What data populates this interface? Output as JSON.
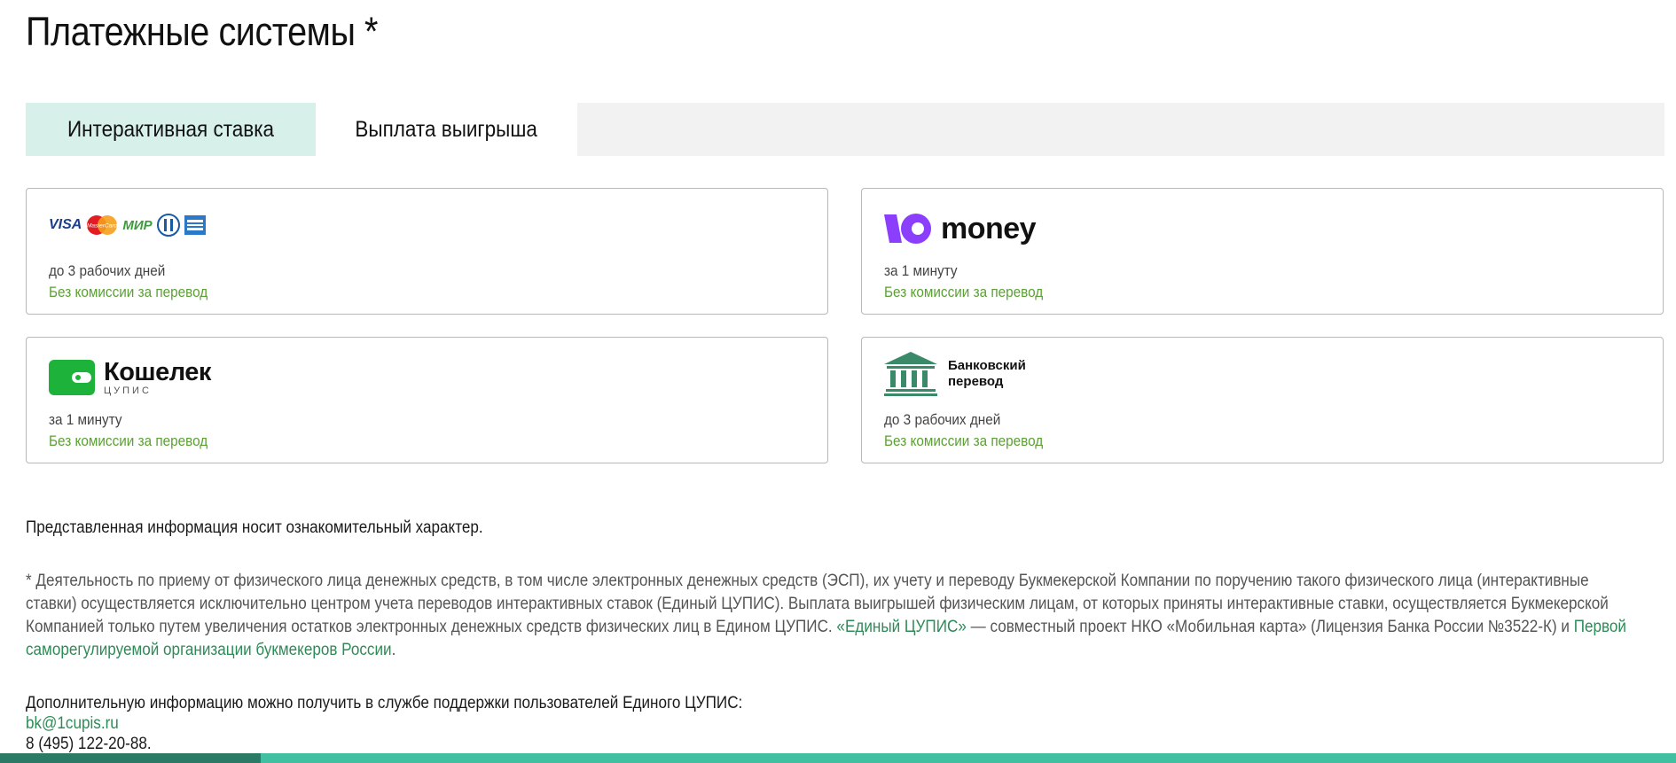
{
  "page": {
    "title": "Платежные системы *"
  },
  "tabs": [
    {
      "label": "Интерактивная ставка",
      "active": false
    },
    {
      "label": "Выплата выигрыша",
      "active": true
    }
  ],
  "cards": [
    {
      "logo": {
        "icons": [
          "visa-icon",
          "mastercard-icon",
          "mir-icon",
          "diners-club-icon",
          "amex-icon"
        ],
        "visa_text": "VISA",
        "mastercard_text": "MasterCard",
        "mir_text": "МИР"
      },
      "time": "до 3 рабочих дней",
      "fee": "Без комиссии за перевод"
    },
    {
      "logo": {
        "icon": "yoomoney-icon",
        "text": "money"
      },
      "time": "за 1 минуту",
      "fee": "Без комиссии за перевод"
    },
    {
      "logo": {
        "icon": "wallet-icon",
        "text": "Кошелек",
        "sub": "ЦУПИС"
      },
      "time": "за 1 минуту",
      "fee": "Без комиссии за перевод"
    },
    {
      "logo": {
        "icon": "bank-building-icon",
        "line1": "Банковский",
        "line2": "перевод"
      },
      "time": "до 3 рабочих дней",
      "fee": "Без комиссии за перевод"
    }
  ],
  "info": {
    "disclaimer": "Представленная информация носит ознакомительный характер.",
    "note_part1": "*  Деятельность по приему от физического лица денежных средств, в том числе электронных денежных средств (ЭСП), их учету и переводу Букмекерской Компании по поручению такого физического лица (интерактивные ставки) осуществляется исключительно центром учета переводов интерактивных ставок (Единый ЦУПИС). Выплата выигрышей физическим лицам, от которых приняты интерактивные ставки, осуществляется Букмекерской Компанией только путем увеличения остатков электронных денежных средств физических лиц в Едином ЦУПИС. ",
    "note_link1": "«Единый ЦУПИС»",
    "note_part2": " — совместный проект НКО «Мобильная карта» (Лицензия Банка России №3522-К) и ",
    "note_link2": "Первой саморегулируемой организации букмекеров России",
    "note_part3": ".",
    "support_text": "Дополнительную информацию можно получить в службе поддержки пользователей Единого ЦУПИС:",
    "email": "bk@1cupis.ru",
    "phone": "8 (495) 122-20-88."
  },
  "colors": {
    "accent_green": "#5ca035",
    "link_green": "#2e8b57",
    "tab_active_bg": "#d8f0ea",
    "yoomoney_purple": "#8b3ffd",
    "wallet_green": "#1db33a",
    "bank_green": "#3a8a6a"
  }
}
